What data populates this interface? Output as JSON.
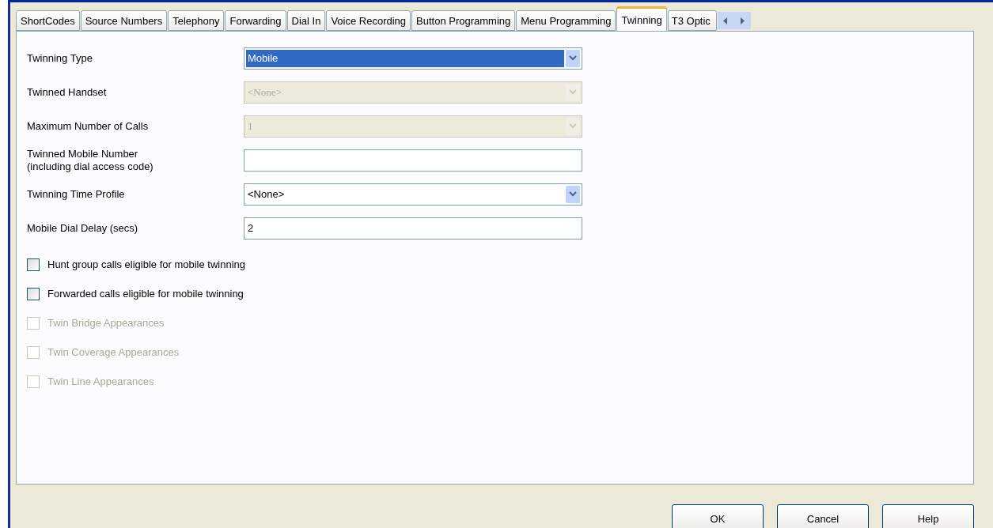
{
  "tabs": [
    {
      "label": "ShortCodes",
      "selected": false
    },
    {
      "label": "Source Numbers",
      "selected": false
    },
    {
      "label": "Telephony",
      "selected": false
    },
    {
      "label": "Forwarding",
      "selected": false
    },
    {
      "label": "Dial In",
      "selected": false
    },
    {
      "label": "Voice Recording",
      "selected": false
    },
    {
      "label": "Button Programming",
      "selected": false
    },
    {
      "label": "Menu Programming",
      "selected": false
    },
    {
      "label": "Twinning",
      "selected": true
    },
    {
      "label": "T3 Optic",
      "selected": false
    }
  ],
  "fields": [
    {
      "label": "Twinning Type",
      "kind": "select",
      "value": "Mobile",
      "disabled": false,
      "focused": true
    },
    {
      "label": "Twinned Handset",
      "kind": "select",
      "value": "<None>",
      "disabled": true,
      "focused": false
    },
    {
      "label": "Maximum Number of Calls",
      "kind": "select",
      "value": "1",
      "disabled": true,
      "focused": false
    },
    {
      "label": "Twinned Mobile Number\n(including dial access code)",
      "kind": "text",
      "disabled": false
    },
    {
      "label": "Twinning Time Profile",
      "kind": "select",
      "value": "<None>",
      "disabled": false,
      "focused": false
    },
    {
      "label": "Mobile Dial Delay (secs)",
      "kind": "text",
      "value": "2",
      "disabled": false
    }
  ],
  "checkboxes": [
    {
      "label": "Hunt group calls eligible for mobile twinning",
      "checked": false,
      "disabled": false
    },
    {
      "label": "Forwarded calls eligible for mobile twinning",
      "checked": false,
      "disabled": false
    },
    {
      "label": "Twin Bridge Appearances",
      "checked": false,
      "disabled": true
    },
    {
      "label": "Twin Coverage Appearances",
      "checked": false,
      "disabled": true
    },
    {
      "label": "Twin Line Appearances",
      "checked": false,
      "disabled": true
    }
  ],
  "buttons": [
    "OK",
    "Cancel",
    "Help"
  ]
}
